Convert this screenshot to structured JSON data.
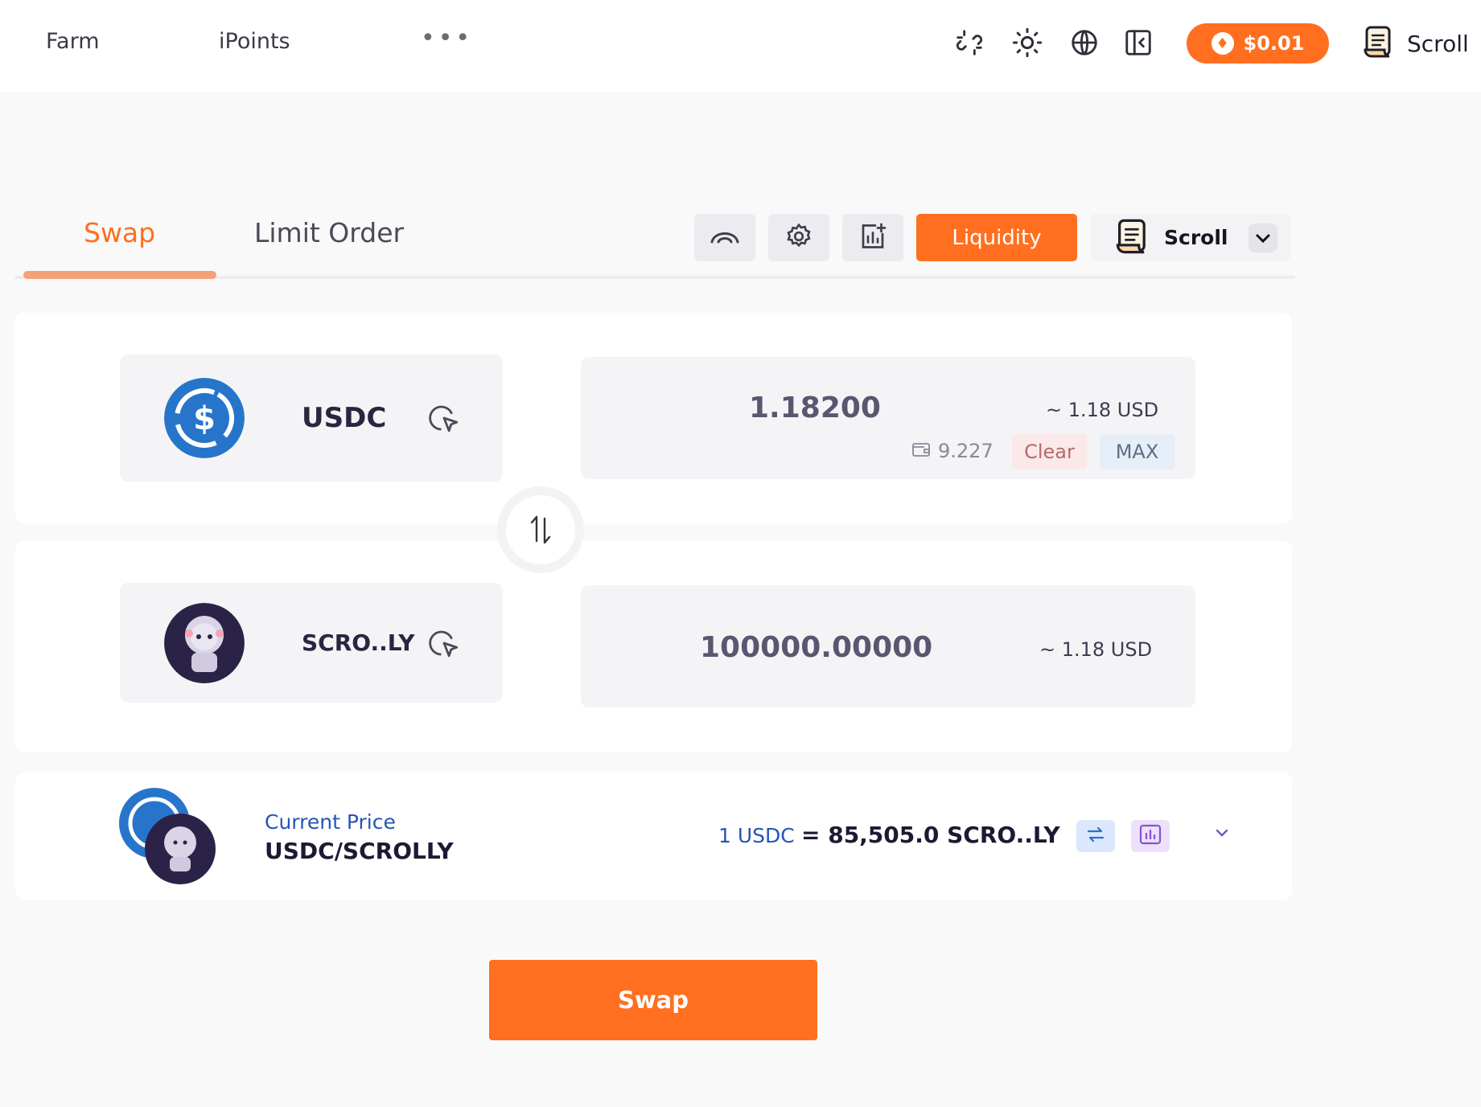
{
  "nav": {
    "links": [
      "Farm",
      "iPoints"
    ],
    "more_label": "•••",
    "price_pill": "$0.01",
    "network_label": "Scroll"
  },
  "tabs": {
    "swap": "Swap",
    "limit_order": "Limit Order"
  },
  "toolbar": {
    "liquidity_label": "Liquidity",
    "network_label": "Scroll"
  },
  "from_token": {
    "symbol": "USDC",
    "amount": "1.18200",
    "usd": "~ 1.18 USD",
    "balance": "9.227",
    "clear_label": "Clear",
    "max_label": "MAX"
  },
  "to_token": {
    "symbol": "SCRO..LY",
    "amount": "100000.00000",
    "usd": "~ 1.18 USD"
  },
  "price_info": {
    "label": "Current Price",
    "pair": "USDC/SCROLLY",
    "rate_left": "1 USDC",
    "rate_right": "= 85,505.0 SCRO..LY"
  },
  "swap_button_label": "Swap",
  "colors": {
    "accent": "#ff6f1f",
    "usdc_blue": "#2775ca",
    "link_blue": "#2356b5"
  },
  "icons": [
    "unlink-icon",
    "sun-icon",
    "globe-icon",
    "collapse-panel-icon",
    "scroll-logo-icon",
    "route-icon",
    "gear-icon",
    "chart-add-icon",
    "chevron-down-icon",
    "cursor-select-icon",
    "wallet-icon",
    "swap-arrows-icon",
    "refresh-icon",
    "bar-chart-icon"
  ]
}
